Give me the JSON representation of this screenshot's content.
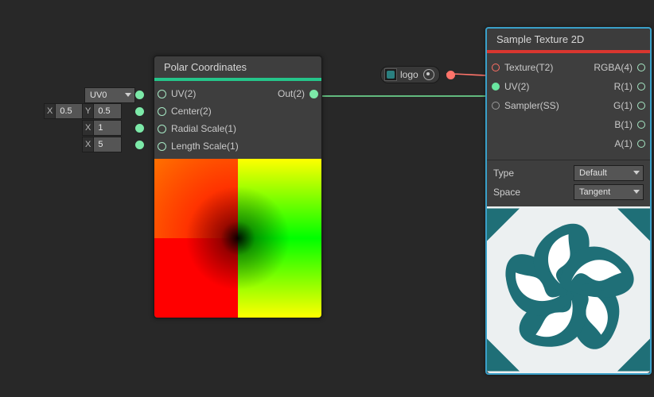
{
  "polar_node": {
    "title": "Polar Coordinates",
    "accent_color": "#2fbc7f",
    "inputs": [
      {
        "label": "UV(2)"
      },
      {
        "label": "Center(2)"
      },
      {
        "label": "Radial Scale(1)"
      },
      {
        "label": "Length Scale(1)"
      }
    ],
    "outputs": [
      {
        "label": "Out(2)"
      }
    ],
    "uv_channel_dropdown": "UV0",
    "center_x_label": "X",
    "center_x_value": "0.5",
    "center_y_label": "Y",
    "center_y_value": "0.5",
    "radial_x_label": "X",
    "radial_x_value": "1",
    "length_x_label": "X",
    "length_x_value": "5"
  },
  "logo_pill": {
    "label": "logo"
  },
  "sample_node": {
    "title": "Sample Texture 2D",
    "inputs": [
      {
        "label": "Texture(T2)"
      },
      {
        "label": "UV(2)"
      },
      {
        "label": "Sampler(SS)"
      }
    ],
    "outputs": [
      {
        "label": "RGBA(4)"
      },
      {
        "label": "R(1)"
      },
      {
        "label": "G(1)"
      },
      {
        "label": "B(1)"
      },
      {
        "label": "A(1)"
      }
    ],
    "settings": {
      "type_label": "Type",
      "type_value": "Default",
      "space_label": "Space",
      "space_value": "Tangent"
    }
  }
}
